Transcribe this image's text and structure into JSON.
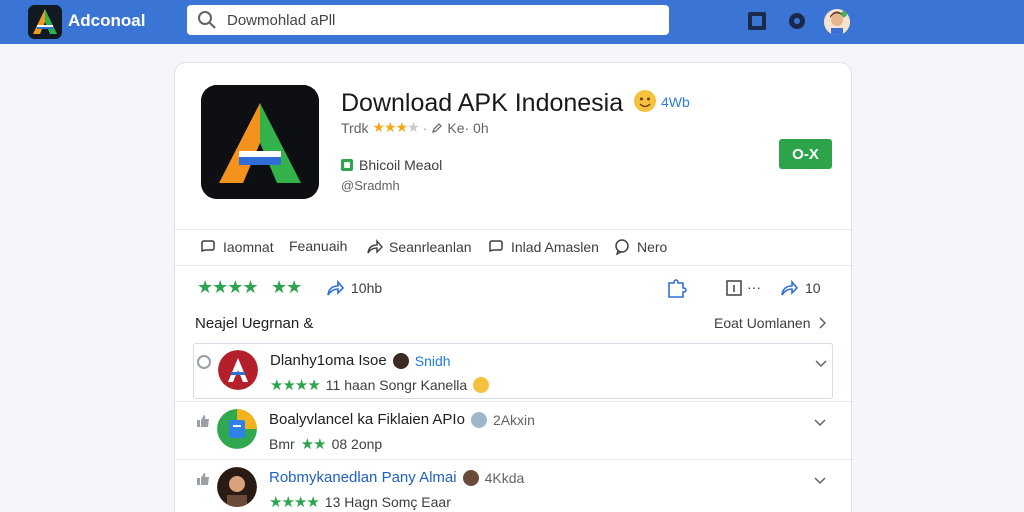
{
  "topbar": {
    "app_name": "Adconoal",
    "search_value": "Dowmohlad aPll"
  },
  "app": {
    "title": "Download APK Indonesia",
    "title_meta": "4Wb",
    "sub_prefix": "Trdk",
    "sub_suffix": "Ke· 0h",
    "developer": "Bhicoil  Meaol",
    "handle": "@Sradmh",
    "install_label": "O-X"
  },
  "actions": [
    {
      "label": "Iaomnat"
    },
    {
      "label": "Feanuaih"
    },
    {
      "label": "Seanrleanlan"
    },
    {
      "label": "Inlad Amaslen"
    },
    {
      "label": "Nero"
    }
  ],
  "ratings": {
    "stars_a": "★★★★",
    "stars_b": "★★",
    "share_count": "10hb",
    "right_count": "10"
  },
  "section": {
    "title": "Neajel Uegrnan &",
    "see_all": "Eoat Uomlanen"
  },
  "list": [
    {
      "title": "Dlanhy1oma Isoe",
      "extra": "Snidh",
      "stars": "★★★★",
      "sub": "11  haan  Songr  Kanella"
    },
    {
      "title": "Boalyvlancel  ka  Fiklaien  APIo",
      "extra": "2Akxin",
      "stars": "★★",
      "sub_prefix": "Bmr",
      "sub": "08  2onp"
    },
    {
      "title": "Robmykanedlan  Pany  Almai",
      "extra": "4Kkda",
      "stars": "★★★★",
      "sub": "13  Hagn  Somç Eaar"
    }
  ],
  "colors": {
    "topbar": "#3a75d6",
    "install": "#2da449",
    "star_yellow": "#f4a916",
    "star_green": "#2ea44f"
  }
}
